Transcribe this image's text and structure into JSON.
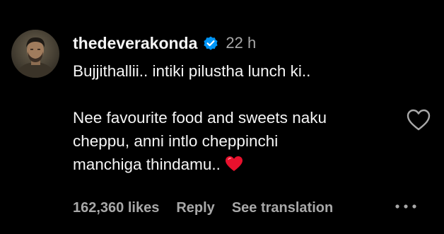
{
  "comment": {
    "username": "thedeverakonda",
    "verified": true,
    "time": "22 h",
    "text_lines": [
      "Bujjithallii.. intiki pilustha lunch ki..",
      "",
      "Nee favourite food and sweets naku",
      "cheppu, anni intlo cheppinchi",
      "manchiga thindamu.."
    ],
    "emoji": "red-heart",
    "likes": "162,360 likes",
    "reply_label": "Reply",
    "translation_label": "See translation"
  },
  "colors": {
    "background": "#000000",
    "primary_text": "#f5f5f5",
    "secondary_text": "#a8a8a8",
    "verified_badge": "#0095f6",
    "heart_emoji": "#e8112d"
  },
  "icons": {
    "verified": "verified-badge-icon",
    "like": "heart-outline-icon",
    "more": "more-options-icon"
  }
}
